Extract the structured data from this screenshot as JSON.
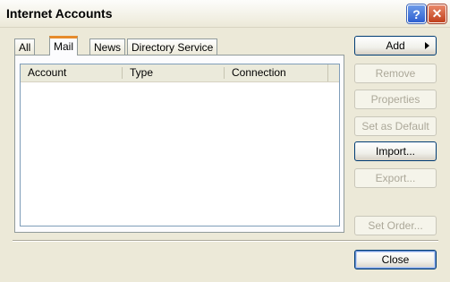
{
  "window": {
    "title": "Internet Accounts",
    "help_label": "?",
    "close_label": "✕"
  },
  "tabs": [
    {
      "label": "All"
    },
    {
      "label": "Mail",
      "active": true
    },
    {
      "label": "News"
    },
    {
      "label": "Directory Service"
    }
  ],
  "list": {
    "columns": [
      "Account",
      "Type",
      "Connection"
    ],
    "rows": []
  },
  "buttons": {
    "add": {
      "label": "Add",
      "enabled": true
    },
    "remove": {
      "label": "Remove",
      "enabled": false
    },
    "properties": {
      "label": "Properties",
      "enabled": false
    },
    "set_default": {
      "label": "Set as Default",
      "enabled": false
    },
    "import": {
      "label": "Import...",
      "enabled": true
    },
    "export": {
      "label": "Export...",
      "enabled": false
    },
    "set_order": {
      "label": "Set Order...",
      "enabled": false
    },
    "close": {
      "label": "Close",
      "enabled": true
    }
  },
  "colors": {
    "dialog_bg": "#ece9d8",
    "active_tab_accent": "#e68b2c",
    "button_border": "#003c74",
    "disabled_text": "#aca899"
  }
}
